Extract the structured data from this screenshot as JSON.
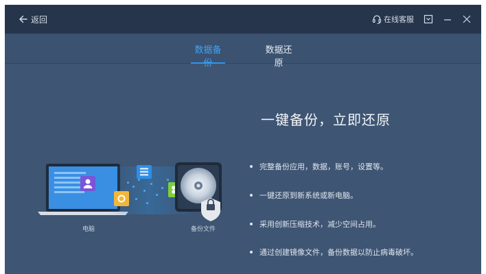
{
  "titlebar": {
    "back_label": "返回",
    "service_label": "在线客服"
  },
  "tabs": [
    {
      "label": "数据备份",
      "active": true
    },
    {
      "label": "数据还原",
      "active": false
    }
  ],
  "main": {
    "headline": "一键备份，立即还原",
    "features": [
      "完整备份应用，数据，账号，设置等。",
      "一键还原到新系统或新电脑。",
      "采用创新压缩技术，减少空间占用。",
      "通过创建镜像文件，备份数据以防止病毒破坏。"
    ],
    "illustration": {
      "computer_label": "电脑",
      "backup_file_label": "备份文件"
    }
  },
  "colors": {
    "titlebar": "#26354c",
    "background": "#3e5573",
    "accent": "#2f95ef"
  },
  "icons": [
    "back-arrow-icon",
    "headset-icon",
    "dropdown-icon",
    "minimize-icon",
    "close-icon"
  ]
}
